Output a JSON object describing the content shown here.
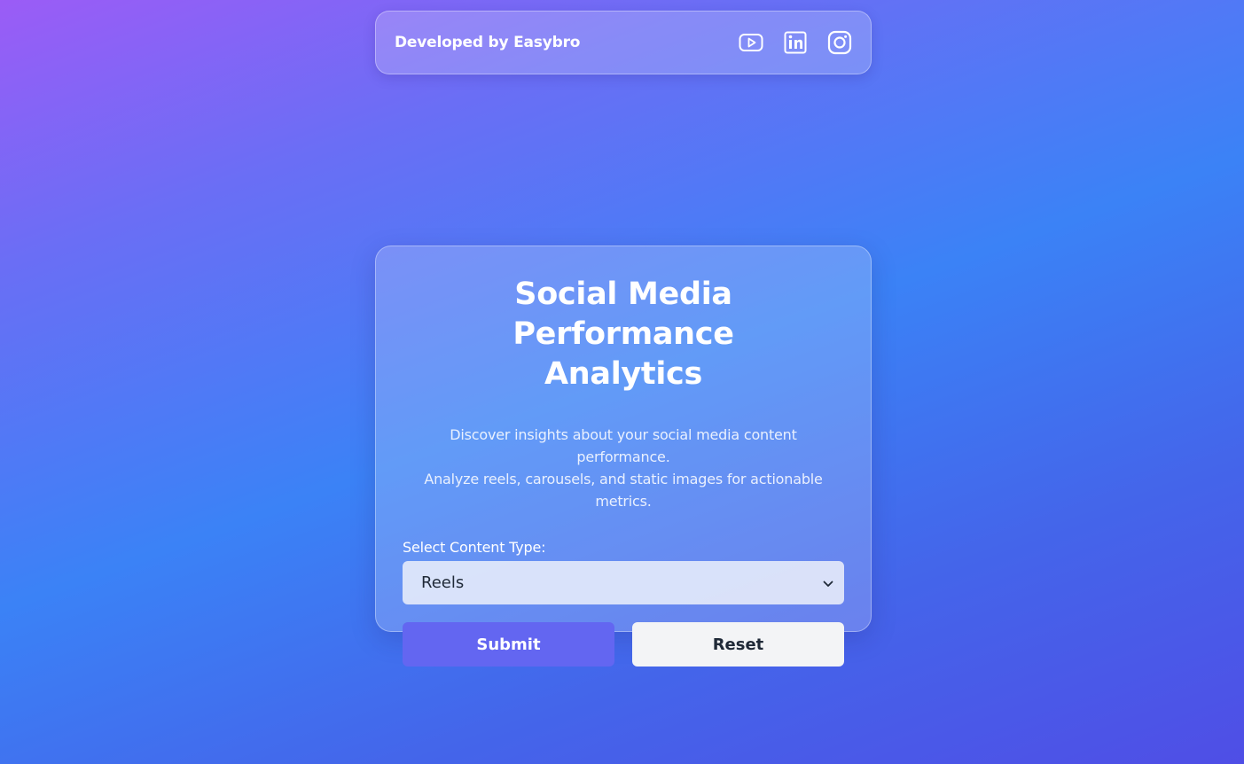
{
  "header": {
    "brand": "Developed by Easybro",
    "social": [
      {
        "icon": "youtube-icon"
      },
      {
        "icon": "linkedin-icon"
      },
      {
        "icon": "instagram-icon"
      }
    ]
  },
  "card": {
    "title_line1": "Social Media Performance",
    "title_line2": "Analytics",
    "description_line1": "Discover insights about your social media content performance.",
    "description_line2": "Analyze reels, carousels, and static images for actionable",
    "description_line3": "metrics.",
    "select_label": "Select Content Type:",
    "select_value": "Reels",
    "submit_label": "Submit",
    "reset_label": "Reset"
  },
  "colors": {
    "gradient_start": "#9b5cf6",
    "gradient_mid": "#3b82f6",
    "gradient_end": "#4f4ee6",
    "submit_bg": "#6366f1",
    "reset_bg": "#f3f4f6"
  }
}
